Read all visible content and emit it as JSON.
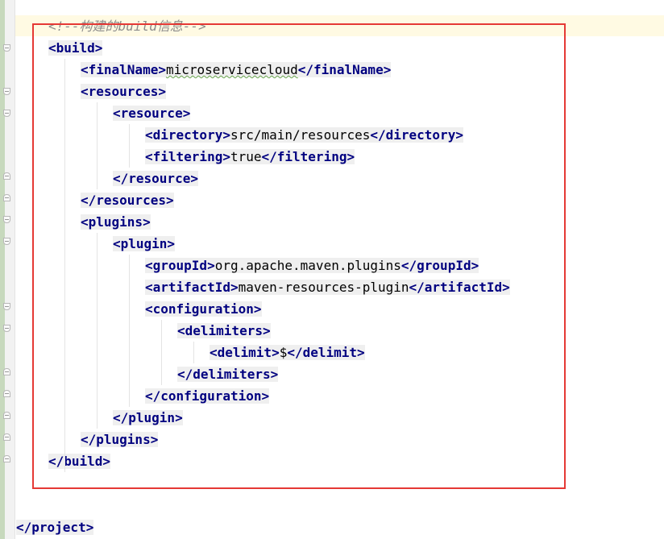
{
  "editor": {
    "comment": "<!--构建的build信息-->",
    "lines": [
      {
        "indent": 0,
        "open": "build"
      },
      {
        "indent": 1,
        "open": "finalName",
        "text": "microservicecloud",
        "close": "finalName",
        "squiggle": true
      },
      {
        "indent": 1,
        "open": "resources"
      },
      {
        "indent": 2,
        "open": "resource"
      },
      {
        "indent": 3,
        "open": "directory",
        "text": "src/main/resources",
        "close": "directory"
      },
      {
        "indent": 3,
        "open": "filtering",
        "text": "true",
        "close": "filtering"
      },
      {
        "indent": 2,
        "close": "resource"
      },
      {
        "indent": 1,
        "close": "resources"
      },
      {
        "indent": 1,
        "open": "plugins"
      },
      {
        "indent": 2,
        "open": "plugin"
      },
      {
        "indent": 3,
        "open": "groupId",
        "text": "org.apache.maven.plugins",
        "close": "groupId"
      },
      {
        "indent": 3,
        "open": "artifactId",
        "text": "maven-resources-plugin",
        "close": "artifactId"
      },
      {
        "indent": 3,
        "open": "configuration"
      },
      {
        "indent": 4,
        "open": "delimiters"
      },
      {
        "indent": 5,
        "open": "delimit",
        "text": "$",
        "close": "delimit"
      },
      {
        "indent": 4,
        "close": "delimiters"
      },
      {
        "indent": 3,
        "close": "configuration"
      },
      {
        "indent": 2,
        "close": "plugin"
      },
      {
        "indent": 1,
        "close": "plugins"
      },
      {
        "indent": 0,
        "close": "build"
      }
    ],
    "project_close": "project"
  },
  "colors": {
    "tag": "#000080",
    "comment": "#8c8c8c",
    "highlight_border": "#e53935",
    "caret_line": "#fffae3",
    "tag_background": "#efefef"
  }
}
